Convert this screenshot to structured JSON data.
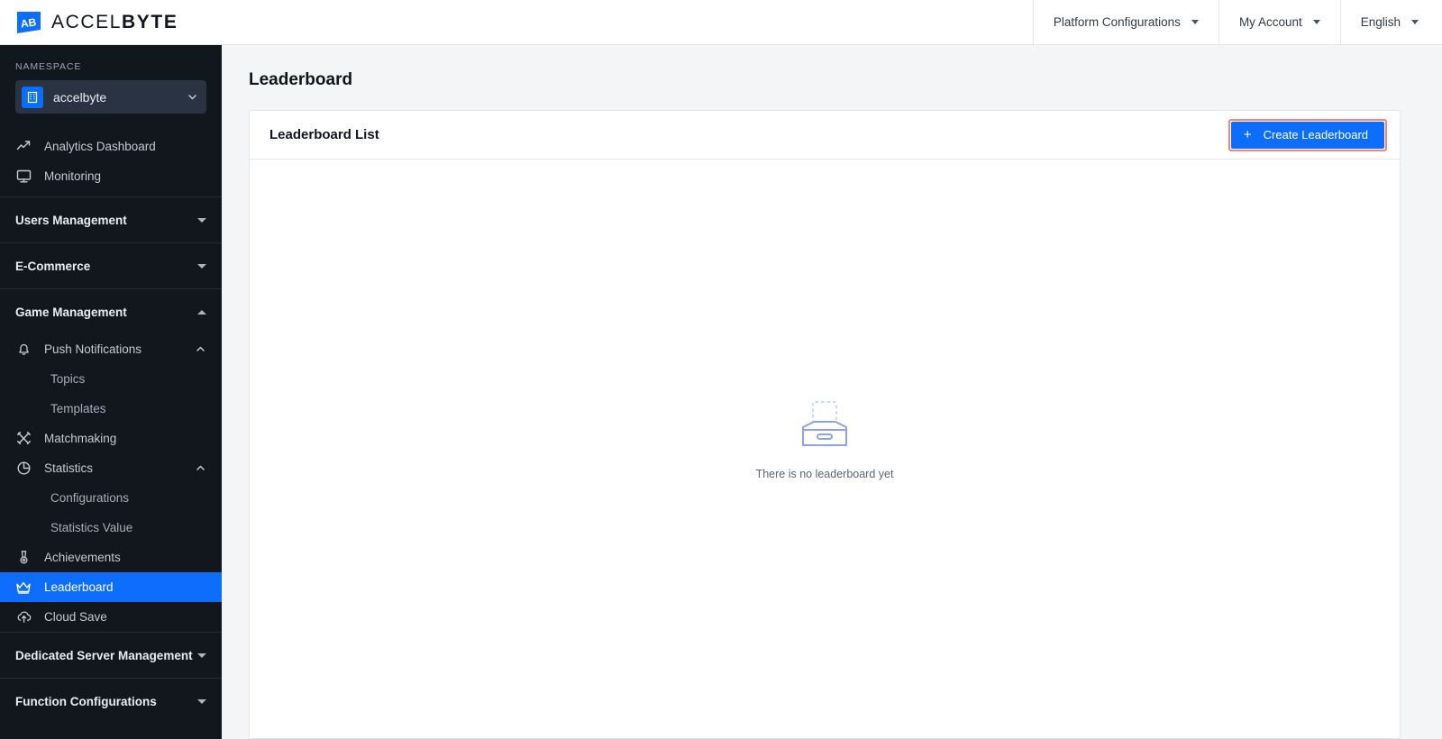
{
  "brand": {
    "logo_icon": "accelbyte-logo-icon",
    "name_light": "ACCEL",
    "name_bold": "BYTE"
  },
  "topnav": {
    "items": [
      {
        "label": "Platform Configurations",
        "icon": "chevron-down-icon"
      },
      {
        "label": "My Account",
        "icon": "chevron-down-icon"
      },
      {
        "label": "English",
        "icon": "chevron-down-icon"
      }
    ]
  },
  "sidebar": {
    "namespace_label": "NAMESPACE",
    "namespace_value": "accelbyte",
    "namespace_icon": "building-icon",
    "namespace_chevron": "chevron-down-icon",
    "top_items": [
      {
        "label": "Analytics Dashboard",
        "icon": "trending-up-icon"
      },
      {
        "label": "Monitoring",
        "icon": "monitor-icon"
      }
    ],
    "sections": [
      {
        "label": "Users Management",
        "state": "collapsed",
        "icon": "chevron-down-icon"
      },
      {
        "label": "E-Commerce",
        "state": "collapsed",
        "icon": "chevron-down-icon"
      },
      {
        "label": "Game Management",
        "state": "expanded",
        "icon": "chevron-up-icon"
      },
      {
        "label": "Dedicated Server Management",
        "state": "collapsed",
        "icon": "chevron-down-icon"
      },
      {
        "label": "Function Configurations",
        "state": "collapsed",
        "icon": "chevron-down-icon"
      }
    ],
    "game_management": [
      {
        "label": "Push Notifications",
        "icon": "bell-icon",
        "state": "expanded",
        "chevron": "chevron-up-icon"
      },
      {
        "label": "Topics",
        "type": "sub"
      },
      {
        "label": "Templates",
        "type": "sub"
      },
      {
        "label": "Matchmaking",
        "icon": "crossed-swords-icon"
      },
      {
        "label": "Statistics",
        "icon": "pie-chart-icon",
        "state": "expanded",
        "chevron": "chevron-up-icon"
      },
      {
        "label": "Configurations",
        "type": "sub"
      },
      {
        "label": "Statistics Value",
        "type": "sub"
      },
      {
        "label": "Achievements",
        "icon": "medal-icon"
      },
      {
        "label": "Leaderboard",
        "icon": "crown-icon",
        "active": true
      },
      {
        "label": "Cloud Save",
        "icon": "cloud-upload-icon"
      }
    ]
  },
  "main": {
    "page_title": "Leaderboard",
    "card_title": "Leaderboard List",
    "create_button": {
      "label": "Create Leaderboard",
      "plus": "+",
      "highlighted": true
    },
    "empty_state": {
      "icon": "empty-inbox-icon",
      "text": "There is no leaderboard yet"
    }
  },
  "colors": {
    "accent": "#0d6efd",
    "sidebar_bg": "#12161d",
    "page_bg": "#f4f5f7",
    "highlight_ring": "#f2837f",
    "empty_art": "#8ea0f0"
  }
}
